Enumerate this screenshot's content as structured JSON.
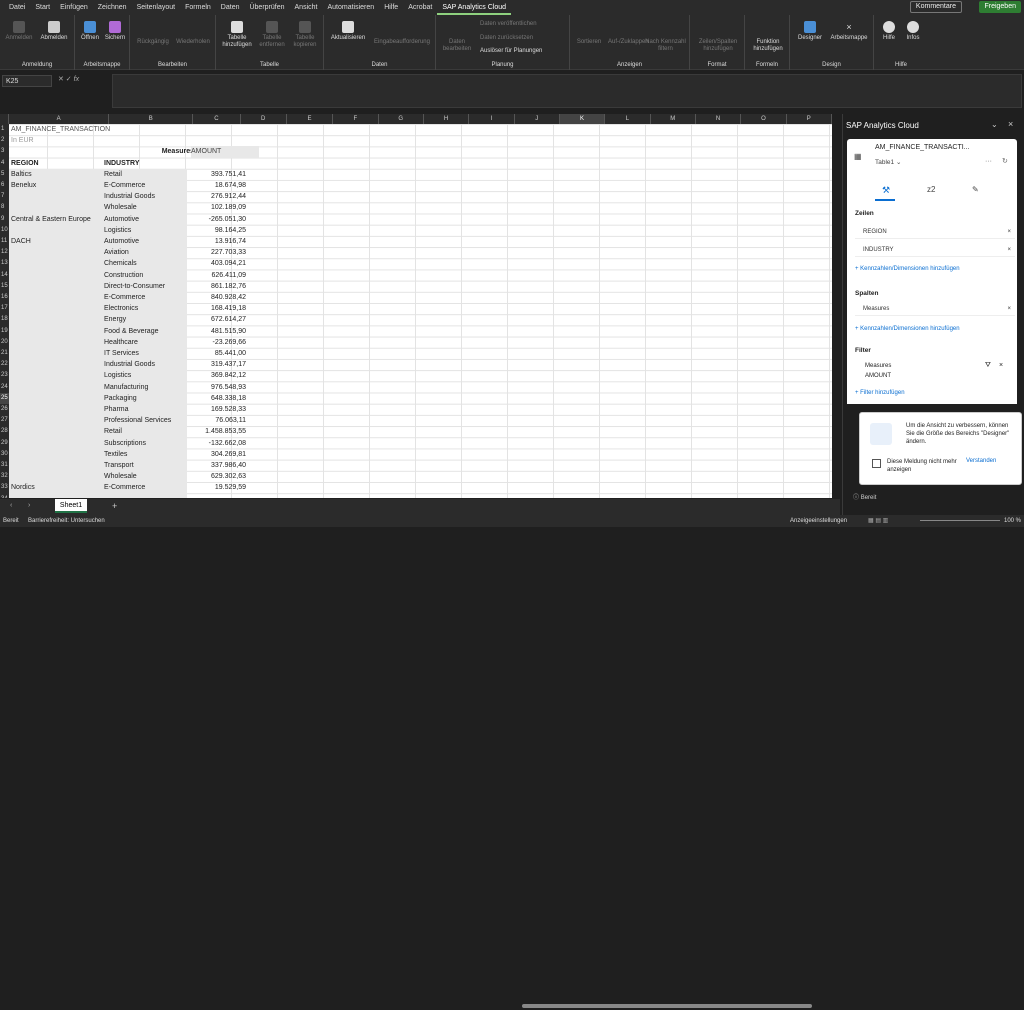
{
  "menu": [
    "Datei",
    "Start",
    "Einfügen",
    "Zeichnen",
    "Seitenlayout",
    "Formeln",
    "Daten",
    "Überprüfen",
    "Ansicht",
    "Automatisieren",
    "Hilfe",
    "Acrobat",
    "SAP Analytics Cloud"
  ],
  "top_buttons": {
    "kommentare": "Kommentare",
    "freigeben": "Freigeben"
  },
  "ribbon": {
    "anmeldung": {
      "label": "Anmeldung",
      "anmelden": "Anmelden",
      "abmelden": "Abmelden"
    },
    "arbeitsmappe": {
      "label": "Arbeitsmappe",
      "oeffnen": "Öffnen",
      "sichern": "Sichern"
    },
    "bearbeiten": {
      "label": "Bearbeiten",
      "rueck": "Rückgängig",
      "wieder": "Wiederholen"
    },
    "tabelle": {
      "label": "Tabelle",
      "hinzu": "Tabelle hinzufügen",
      "entfernen": "Tabelle entfernen",
      "kopieren": "Tabelle kopieren"
    },
    "daten": {
      "label": "Daten",
      "aktual": "Aktualisieren",
      "eingabe": "Eingabeaufforderung"
    },
    "planung": {
      "label": "Planung",
      "bearb": "Daten bearbeiten",
      "veroef": "Daten veröffentlichen",
      "zurueck": "Daten zurücksetzen",
      "ausloeser": "Auslöser für Planungen"
    },
    "anzeigen": {
      "label": "Anzeigen",
      "sortieren": "Sortieren",
      "auf": "Auf-/Zuklappen",
      "kennzahl": "Nach Kennzahl filtern"
    },
    "format": {
      "label": "Format",
      "zeilen": "Zeilen/Spalten hinzufügen"
    },
    "formeln": {
      "label": "Formeln",
      "funktion": "Funktion hinzufügen"
    },
    "design": {
      "label": "Design",
      "designer": "Designer",
      "arbeitsmappe": "Arbeitsmappe"
    },
    "hilfe": {
      "label": "Hilfe",
      "hilfe": "Hilfe",
      "infos": "Infos"
    }
  },
  "namebox": "K25",
  "columns": [
    "A",
    "B",
    "C",
    "D",
    "E",
    "F",
    "G",
    "H",
    "I",
    "J",
    "K",
    "L",
    "M",
    "N",
    "O",
    "P"
  ],
  "sheet": {
    "title": "AM_FINANCE_TRANSACTION",
    "currency": "In EUR",
    "measures": "Measures",
    "amount": "AMOUNT",
    "region_h": "REGION",
    "industry_h": "INDUSTRY",
    "rows": [
      [
        "Baltics",
        "Retail",
        "393.751,41"
      ],
      [
        "Benelux",
        "E-Commerce",
        "18.674,98"
      ],
      [
        "",
        "Industrial Goods",
        "276.912,44"
      ],
      [
        "",
        "Wholesale",
        "102.189,09"
      ],
      [
        "Central & Eastern Europe",
        "Automotive",
        "-265.051,30"
      ],
      [
        "",
        "Logistics",
        "98.164,25"
      ],
      [
        "DACH",
        "Automotive",
        "13.916,74"
      ],
      [
        "",
        "Aviation",
        "227.703,33"
      ],
      [
        "",
        "Chemicals",
        "403.094,21"
      ],
      [
        "",
        "Construction",
        "626.411,09"
      ],
      [
        "",
        "Direct-to-Consumer",
        "861.182,76"
      ],
      [
        "",
        "E-Commerce",
        "840.928,42"
      ],
      [
        "",
        "Electronics",
        "168.419,18"
      ],
      [
        "",
        "Energy",
        "672.614,27"
      ],
      [
        "",
        "Food & Beverage",
        "481.515,90"
      ],
      [
        "",
        "Healthcare",
        "-23.269,66"
      ],
      [
        "",
        "IT Services",
        "85.441,00"
      ],
      [
        "",
        "Industrial Goods",
        "319.437,17"
      ],
      [
        "",
        "Logistics",
        "369.842,12"
      ],
      [
        "",
        "Manufacturing",
        "976.548,93"
      ],
      [
        "",
        "Packaging",
        "648.338,18"
      ],
      [
        "",
        "Pharma",
        "169.528,33"
      ],
      [
        "",
        "Professional Services",
        "76.063,11"
      ],
      [
        "",
        "Retail",
        "1.458.853,55"
      ],
      [
        "",
        "Subscriptions",
        "-132.662,08"
      ],
      [
        "",
        "Textiles",
        "304.269,81"
      ],
      [
        "",
        "Transport",
        "337.986,40"
      ],
      [
        "",
        "Wholesale",
        "629.302,63"
      ],
      [
        "Nordics",
        "E-Commerce",
        "19.529,59"
      ]
    ]
  },
  "sheet_tab": "Sheet1",
  "status": {
    "bereit": "Bereit",
    "barriere": "Barrierefreiheit: Untersuchen",
    "anzeige": "Anzeigeeinstellungen",
    "zoom": "100 %"
  },
  "panel": {
    "title": "SAP Analytics Cloud",
    "source": "AM_FINANCE_TRANSACTI...",
    "table": "Table1",
    "zeilen": "Zeilen",
    "region": "REGION",
    "industry": "INDUSTRY",
    "add_dim": "Kennzahlen/Dimensionen hinzufügen",
    "spalten": "Spalten",
    "measures": "Measures",
    "filter": "Filter",
    "filter_measures": "Measures",
    "filter_amount": "AMOUNT",
    "filter_add": "Filter hinzufügen",
    "msg": "Um die Ansicht zu verbessern, können Sie die Größe des Bereichs \"Designer\" ändern.",
    "dont_show": "Diese Meldung nicht mehr anzeigen",
    "verstanden": "Verstanden",
    "footer": "Bereit"
  }
}
